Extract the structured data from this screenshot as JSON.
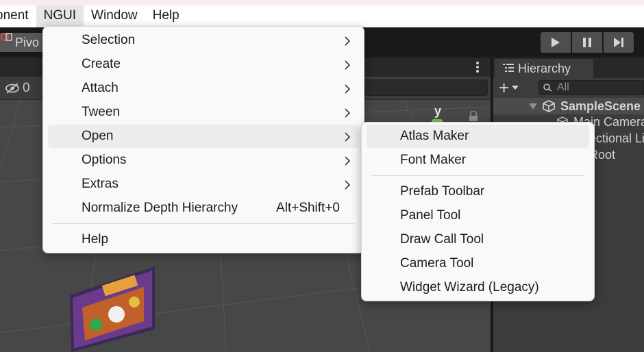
{
  "menubar": {
    "items": [
      {
        "label": "onent"
      },
      {
        "label": "NGUI"
      },
      {
        "label": "Window"
      },
      {
        "label": "Help"
      }
    ]
  },
  "toolbar": {
    "pivot_label": "Pivo",
    "play_icons": [
      "play-icon",
      "pause-icon",
      "step-icon"
    ]
  },
  "scene": {
    "hidden_count": "0",
    "gizmo_axis": "y"
  },
  "hierarchy": {
    "tab_label": "Hierarchy",
    "search_placeholder": "All",
    "scene_name": "SampleScene",
    "items": [
      "Main Camera",
      "Directional Light",
      "UI Root"
    ]
  },
  "ngui_menu": {
    "items": [
      {
        "label": "Selection",
        "submenu": true
      },
      {
        "label": "Create",
        "submenu": true
      },
      {
        "label": "Attach",
        "submenu": true
      },
      {
        "label": "Tween",
        "submenu": true
      },
      {
        "label": "Open",
        "submenu": true,
        "highlighted": true
      },
      {
        "label": "Options",
        "submenu": true
      },
      {
        "label": "Extras",
        "submenu": true
      },
      {
        "label": "Normalize Depth Hierarchy",
        "shortcut": "Alt+Shift+0"
      },
      {
        "label": "Help"
      }
    ]
  },
  "open_submenu": {
    "items": [
      {
        "label": "Atlas Maker",
        "highlighted": true
      },
      {
        "label": "Font Maker"
      },
      {
        "label": "Prefab Toolbar"
      },
      {
        "label": "Panel Tool"
      },
      {
        "label": "Draw Call Tool"
      },
      {
        "label": "Camera Tool"
      },
      {
        "label": "Widget Wizard (Legacy)"
      }
    ]
  },
  "colors": {
    "menu_bg": "#f9f9f9",
    "menu_highlight": "#ececec",
    "editor_dark": "#191919",
    "panel": "#3c3c3c"
  }
}
